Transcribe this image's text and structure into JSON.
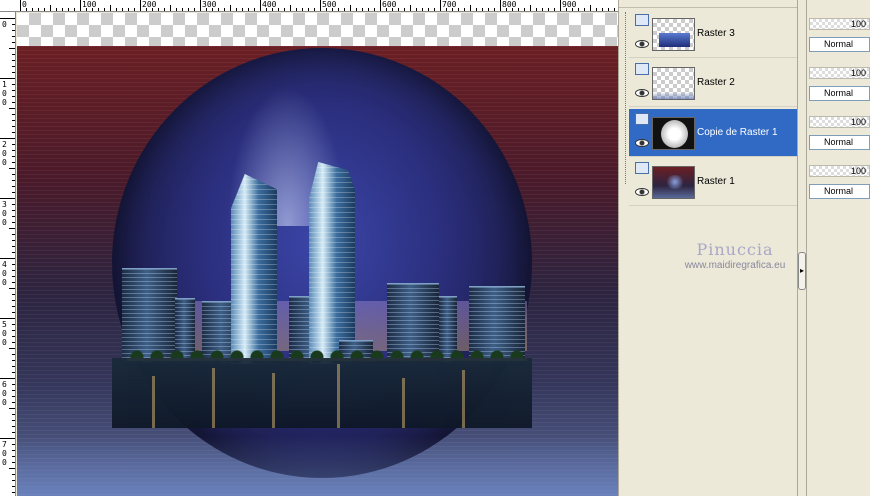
{
  "ruler": {
    "top_labels": [
      "0",
      "100",
      "200",
      "300",
      "400",
      "500",
      "600",
      "700",
      "800",
      "900"
    ],
    "left_labels": [
      "0",
      "1\n0\n0",
      "2\n0\n0",
      "3\n0\n0",
      "4\n0\n0",
      "5\n0\n0",
      "6\n0\n0",
      "7\n0\n0"
    ]
  },
  "layers": [
    {
      "name": "Raster 3",
      "visible": true,
      "selected": false
    },
    {
      "name": "Raster 2",
      "visible": true,
      "selected": false
    },
    {
      "name": "Copie de Raster 1",
      "visible": true,
      "selected": true
    },
    {
      "name": "Raster 1",
      "visible": true,
      "selected": false
    }
  ],
  "properties": [
    {
      "opacity": "100",
      "blend": "Normal"
    },
    {
      "opacity": "100",
      "blend": "Normal"
    },
    {
      "opacity": "100",
      "blend": "Normal"
    },
    {
      "opacity": "100",
      "blend": "Normal"
    }
  ],
  "watermark": {
    "title": "Pinuccia",
    "url": "www.maidiregrafica.eu"
  },
  "splitter": {
    "arrow": "▸"
  },
  "colors": {
    "selection": "#316ac5",
    "panel": "#ece9d8"
  }
}
